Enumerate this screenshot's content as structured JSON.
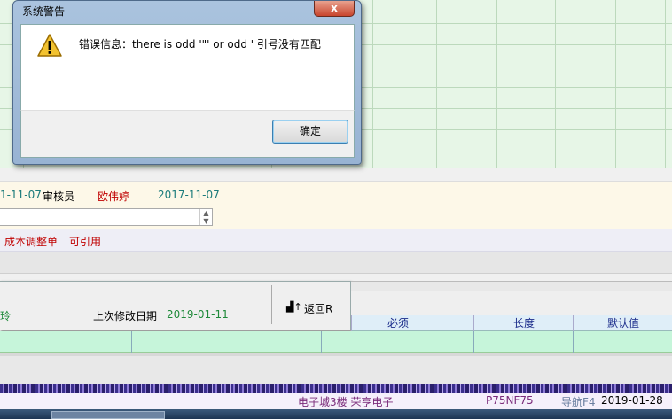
{
  "dialog": {
    "title": "系统警告",
    "close_glyph": "x",
    "icon": "warning-icon",
    "message": "错误信息：there is odd '\"' or odd ' 引号没有匹配",
    "ok_label": "确定"
  },
  "info": {
    "date_partial": "1-11-07",
    "reviewer_label": "审核员",
    "reviewer_name": "欧伟婷",
    "review_date": "2017-11-07"
  },
  "flags": {
    "cost_adjust": "成本调整单",
    "citable": "可引用"
  },
  "panel": {
    "name_partial": "玲",
    "last_modified_label": "上次修改日期",
    "last_modified_date": "2019-01-11",
    "back_button": "返回R"
  },
  "table_headers": [
    "必须",
    "长度",
    "默认值"
  ],
  "status": {
    "location": "电子城3楼 荣亨电子",
    "code": "P75NF75",
    "nav": "导航F4",
    "date": "2019-01-28"
  },
  "colors": {
    "grid": "#e7f6e7",
    "green_row": "#c6f5da",
    "accent_red": "#c00000"
  }
}
